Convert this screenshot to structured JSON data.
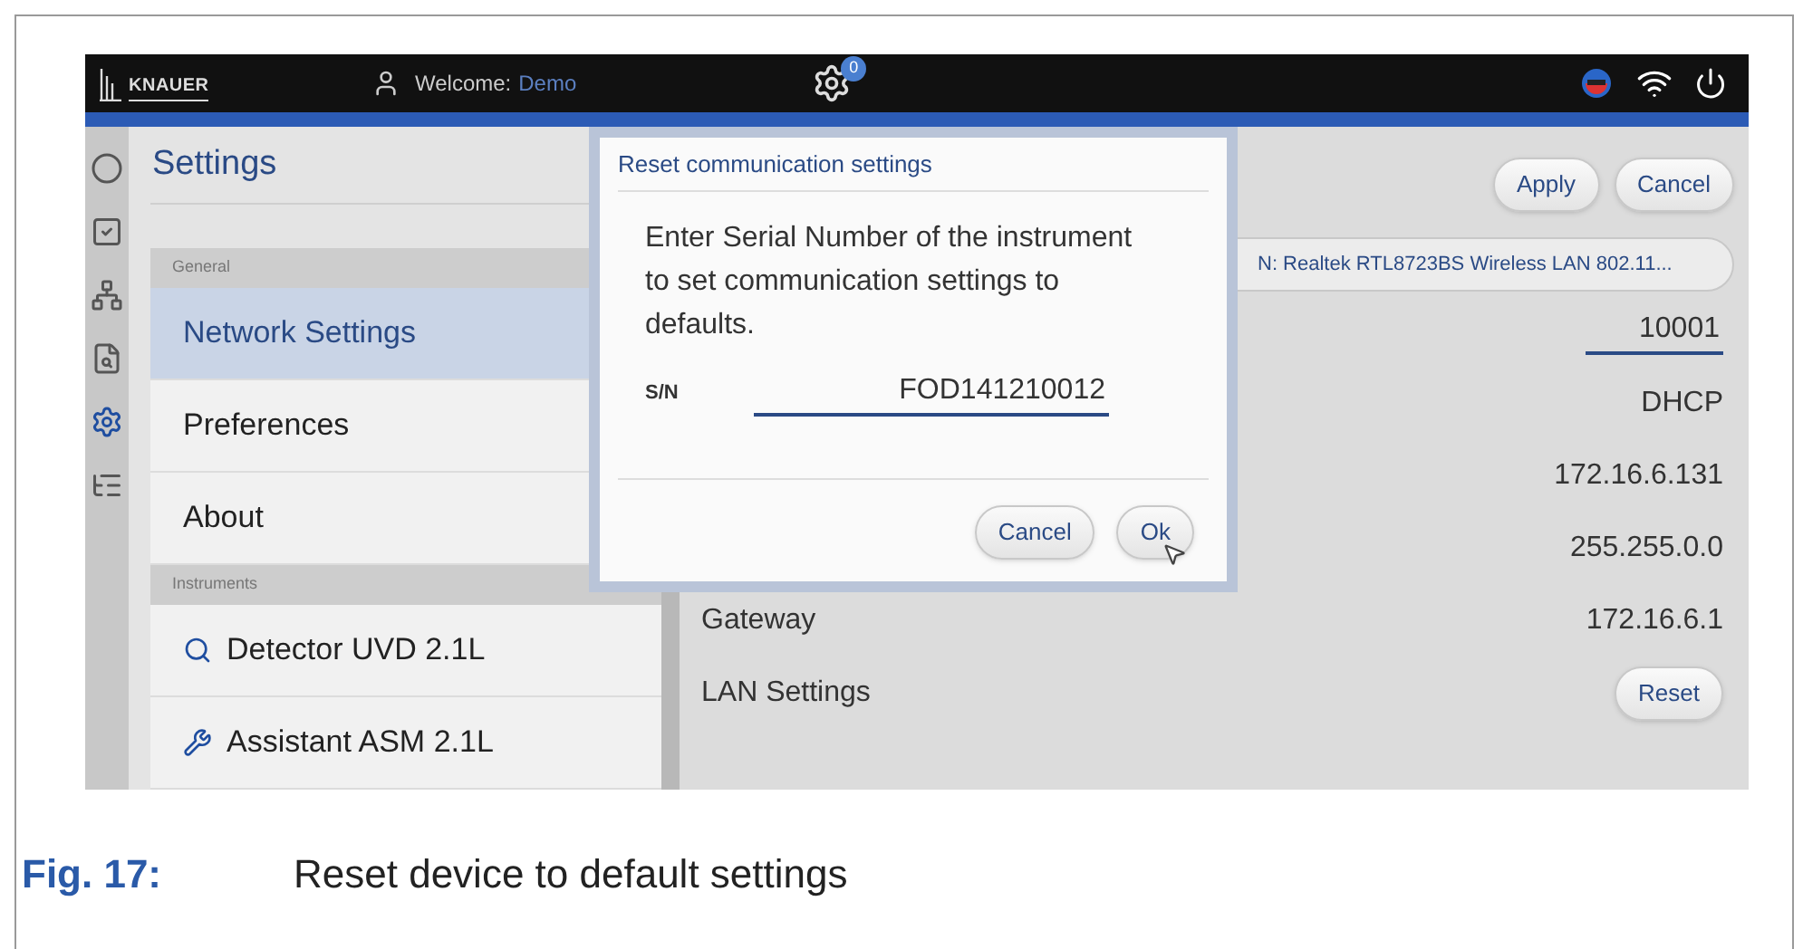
{
  "header": {
    "brand": "KNAUER",
    "welcome_label": "Welcome:",
    "user": "Demo",
    "badge": "0"
  },
  "rail": [
    {
      "selected": false
    },
    {
      "selected": false
    },
    {
      "selected": false
    },
    {
      "selected": false
    },
    {
      "selected": true
    },
    {
      "selected": false
    }
  ],
  "settings": {
    "title": "Settings",
    "sections": [
      {
        "heading": "General",
        "items": [
          {
            "label": "Network Settings",
            "selected": true
          },
          {
            "label": "Preferences",
            "selected": false
          },
          {
            "label": "About",
            "selected": false
          }
        ]
      },
      {
        "heading": "Instruments",
        "items": [
          {
            "label": "Detector UVD 2.1L",
            "selected": false
          },
          {
            "label": "Assistant ASM 2.1L",
            "selected": false
          }
        ]
      }
    ]
  },
  "network": {
    "buttons": [
      "Apply",
      "Cancel"
    ],
    "interface": "N: Realtek RTL8723BS Wireless LAN 802.11...",
    "rows": [
      {
        "kind": "field",
        "value": "10001"
      },
      {
        "kind": "text",
        "value": "DHCP"
      },
      {
        "kind": "text",
        "value": "172.16.6.131"
      },
      {
        "kind": "text",
        "value": "255.255.0.0"
      },
      {
        "kind": "text",
        "label": "Gateway",
        "value": "172.16.6.1"
      },
      {
        "kind": "button",
        "label": "LAN Settings",
        "value": "Reset"
      }
    ]
  },
  "dialog": {
    "title": "Reset communication settings",
    "message": "Enter Serial Number of the instrument to set communication settings to defaults.",
    "field_label": "S/N",
    "value": "FOD141210012",
    "buttons": [
      "Cancel",
      "Ok"
    ]
  },
  "caption": {
    "label": "Fig. 17:",
    "text": "Reset device to default settings"
  }
}
